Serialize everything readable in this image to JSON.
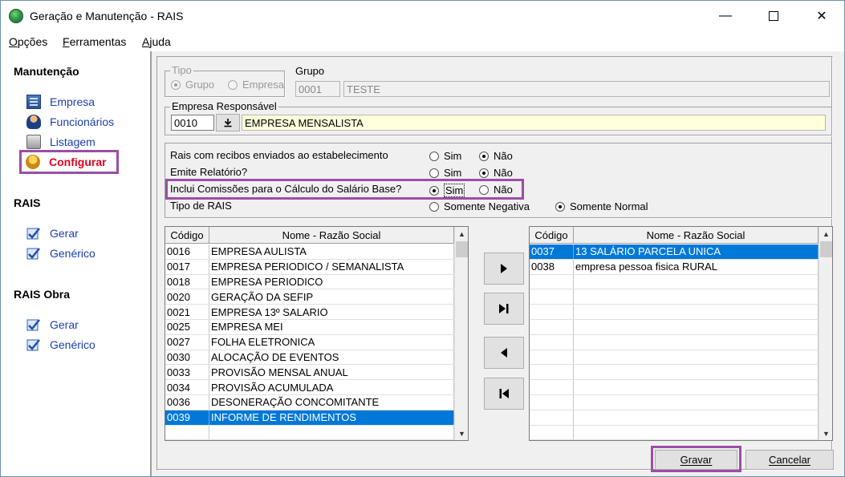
{
  "window": {
    "title": "Geração e Manutenção - RAIS"
  },
  "menu": [
    {
      "label": "Opções",
      "key": "O"
    },
    {
      "label": "Ferramentas",
      "key": "F"
    },
    {
      "label": "Ajuda",
      "key": "A"
    }
  ],
  "sidebar": {
    "sections": [
      {
        "title": "Manutenção",
        "items": [
          "Empresa",
          "Funcionários",
          "Listagem",
          "Configurar"
        ]
      },
      {
        "title": "RAIS",
        "items": [
          "Gerar",
          "Genérico"
        ]
      },
      {
        "title": "RAIS Obra",
        "items": [
          "Gerar",
          "Genérico"
        ]
      }
    ]
  },
  "tipo": {
    "label": "Tipo",
    "option_grupo": "Grupo",
    "option_empresa": "Empresa",
    "selected": "Grupo"
  },
  "grupo": {
    "label": "Grupo",
    "code": "0001",
    "name": "TESTE"
  },
  "empresa_responsavel": {
    "label": "Empresa Responsável",
    "code": "0010",
    "name": "EMPRESA MENSALISTA"
  },
  "options": {
    "q1": {
      "label": "Rais com recibos enviados ao estabelecimento",
      "yes": "Sim",
      "no": "Não",
      "selected": "Não"
    },
    "q2": {
      "label": "Emite Relatório?",
      "yes": "Sim",
      "no": "Não",
      "selected": "Não"
    },
    "q3": {
      "label": "Inclui Comissões para o Cálculo do Salário Base?",
      "yes": "Sim",
      "no": "Não",
      "selected": "Sim"
    },
    "q4": {
      "label": "Tipo de RAIS",
      "opt_a": "Somente Negativa",
      "opt_b": "Somente Normal",
      "selected": "Somente Normal"
    }
  },
  "left_grid": {
    "headers": [
      "Código",
      "Nome - Razão Social"
    ],
    "rows": [
      [
        "0016",
        "EMPRESA AULISTA"
      ],
      [
        "0017",
        "EMPRESA PERIODICO / SEMANALISTA"
      ],
      [
        "0018",
        "EMPRESA PERIODICO"
      ],
      [
        "0020",
        "GERAÇÃO DA SEFIP"
      ],
      [
        "0021",
        "EMPRESA 13º SALARIO"
      ],
      [
        "0025",
        "EMPRESA MEI"
      ],
      [
        "0027",
        "FOLHA ELETRONICA"
      ],
      [
        "0030",
        "ALOCAÇÃO DE EVENTOS"
      ],
      [
        "0033",
        "PROVISÃO MENSAL ANUAL"
      ],
      [
        "0034",
        "PROVISÃO ACUMULADA"
      ],
      [
        "0036",
        "DESONERAÇÃO CONCOMITANTE"
      ],
      [
        "0039",
        "INFORME DE RENDIMENTOS"
      ]
    ],
    "selected_index": 11
  },
  "right_grid": {
    "headers": [
      "Código",
      "Nome - Razão Social"
    ],
    "rows": [
      [
        "0037",
        "13 SALÁRIO PARCELA UNICA"
      ],
      [
        "0038",
        "empresa pessoa fisica RURAL"
      ]
    ],
    "selected_index": 0
  },
  "buttons": {
    "save": "Gravar",
    "cancel": "Cancelar"
  },
  "colors": {
    "accent_highlight": "#9b4ea5",
    "selection": "#0078d7",
    "link": "#1a3fb0",
    "active_item": "#e0001c"
  }
}
